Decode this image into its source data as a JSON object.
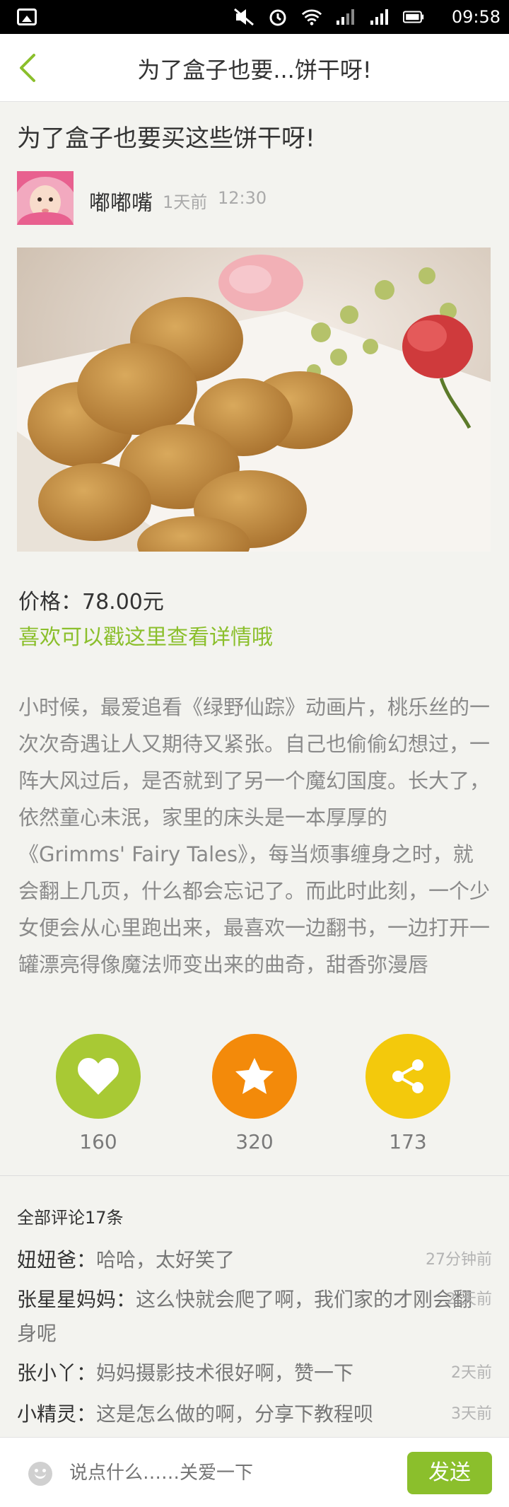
{
  "status_bar": {
    "time": "09:58"
  },
  "header": {
    "title": "为了盒子也要...饼干呀!"
  },
  "article": {
    "title": "为了盒子也要买这些饼干呀!",
    "author": "嘟嘟嘴",
    "posted_ago": "1天前",
    "posted_time": "12:30",
    "price": "价格：78.00元",
    "detail_link": "喜欢可以戳这里查看详情哦",
    "body": " 小时候，最爱追看《绿野仙踪》动画片，桃乐丝的一次次奇遇让人又期待又紧张。自己也偷偷幻想过，一阵大风过后，是否就到了另一个魔幻国度。长大了，依然童心未泯，家里的床头是一本厚厚的《Grimms' Fairy Tales》，每当烦事缠身之时，就会翻上几页，什么都会忘记了。而此时此刻，一个少女便会从心里跑出来，最喜欢一边翻书，一边打开一罐漂亮得像魔法师变出来的曲奇，甜香弥漫唇"
  },
  "actions": {
    "like_count": "160",
    "favorite_count": "320",
    "share_count": "173",
    "colors": {
      "like": "#a8c934",
      "favorite": "#f38a0a",
      "share": "#f3c90c"
    }
  },
  "comments": {
    "header": "全部评论17条",
    "items": [
      {
        "user": "妞妞爸：",
        "text": "哈哈，太好笑了",
        "time": "27分钟前"
      },
      {
        "user": "张星星妈妈：",
        "text": "这么快就会爬了啊，我们家的才刚会翻身呢",
        "time": "2 天前"
      },
      {
        "user": "张小丫：",
        "text": "妈妈摄影技术很好啊，赞一下",
        "time": "2天前"
      },
      {
        "user": "小精灵：",
        "text": "这是怎么做的啊，分享下教程呗",
        "time": "3天前"
      }
    ]
  },
  "input_bar": {
    "placeholder": "说点什么……关爱一下",
    "send_label": "发送"
  },
  "accent_color": "#8bbf2c"
}
